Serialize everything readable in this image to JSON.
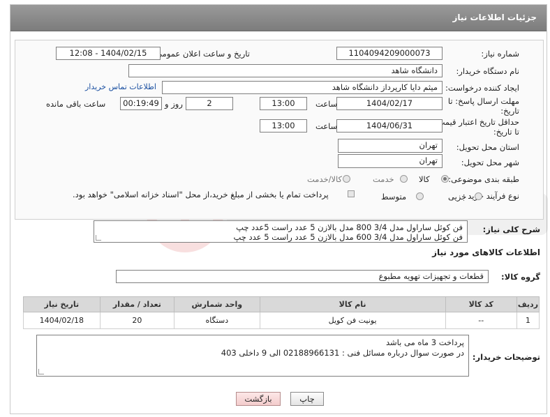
{
  "header": {
    "title": "جزئیات اطلاعات نیاز"
  },
  "form": {
    "need_number_label": "شماره نیاز:",
    "need_number": "1104094209000073",
    "announce_label": "تاریخ و ساعت اعلان عمومی:",
    "announce_value": "1404/02/15 - 12:08",
    "buyer_org_label": "نام دستگاه خریدار:",
    "buyer_org": "دانشگاه شاهد",
    "creator_label": "ایجاد کننده درخواست:",
    "creator": "میثم دایا کارپرداز دانشگاه شاهد",
    "contact_link": "اطلاعات تماس خریدار",
    "deadline_label_1": "مهلت ارسال پاسخ: تا",
    "deadline_label_2": "تاریخ:",
    "deadline_date": "1404/02/17",
    "hour_label": "ساعت",
    "deadline_time": "13:00",
    "days_value": "2",
    "days_label": "روز و",
    "remaining_time": "00:19:49",
    "remaining_label": "ساعت باقی مانده",
    "validity_label_1": "حداقل تاریخ اعتبار قیمت:",
    "validity_label_2": "تا تاریخ:",
    "validity_date": "1404/06/31",
    "validity_time": "13:00",
    "province_label": "استان محل تحویل:",
    "province": "تهران",
    "city_label": "شهر محل تحویل:",
    "city": "تهران",
    "category_label": "طبقه بندی موضوعی:",
    "category_options": [
      "کالا",
      "خدمت",
      "کالا/خدمت"
    ],
    "process_label": "نوع فرآیند خرید :",
    "process_options": [
      "جزیی",
      "متوسط"
    ],
    "payment_note": "پرداخت تمام یا بخشی از مبلغ خرید،از محل \"اسناد خزانه اسلامی\" خواهد بود."
  },
  "description": {
    "label": "شرح کلی نیاز:",
    "line1": "فن کوئل ساراول مدل 3/4 800 مدل بالازن 5 عدد راست 5عدد چپ",
    "line2": "فن کوئل ساراول مدل 3/4  600 مدل بالازن 5 عدد راست 5 عدد چپ"
  },
  "goods": {
    "section_title": "اطلاعات کالاهای مورد نیاز",
    "group_label": "گروه کالا:",
    "group_value": "قطعات و تجهیزات تهویه مطبوع",
    "columns": [
      "ردیف",
      "کد کالا",
      "نام کالا",
      "واحد شمارش",
      "تعداد / مقدار",
      "تاریخ نیاز"
    ],
    "rows": [
      [
        "1",
        "--",
        "یونیت فن کویل",
        "دستگاه",
        "20",
        "1404/02/18"
      ]
    ]
  },
  "notes": {
    "label": "توضیحات خریدار:",
    "line1": "پرداخت 3 ماه می باشد",
    "line2": "در صورت سوال درباره مسائل فنی : 02188966131 الی 9 داخلی 403"
  },
  "buttons": {
    "print": "چاپ",
    "back": "بازگشت"
  },
  "colors": {
    "header_bg": "#8a8a8a",
    "link": "#1a4fa0",
    "back_button": "#f3cccc"
  }
}
